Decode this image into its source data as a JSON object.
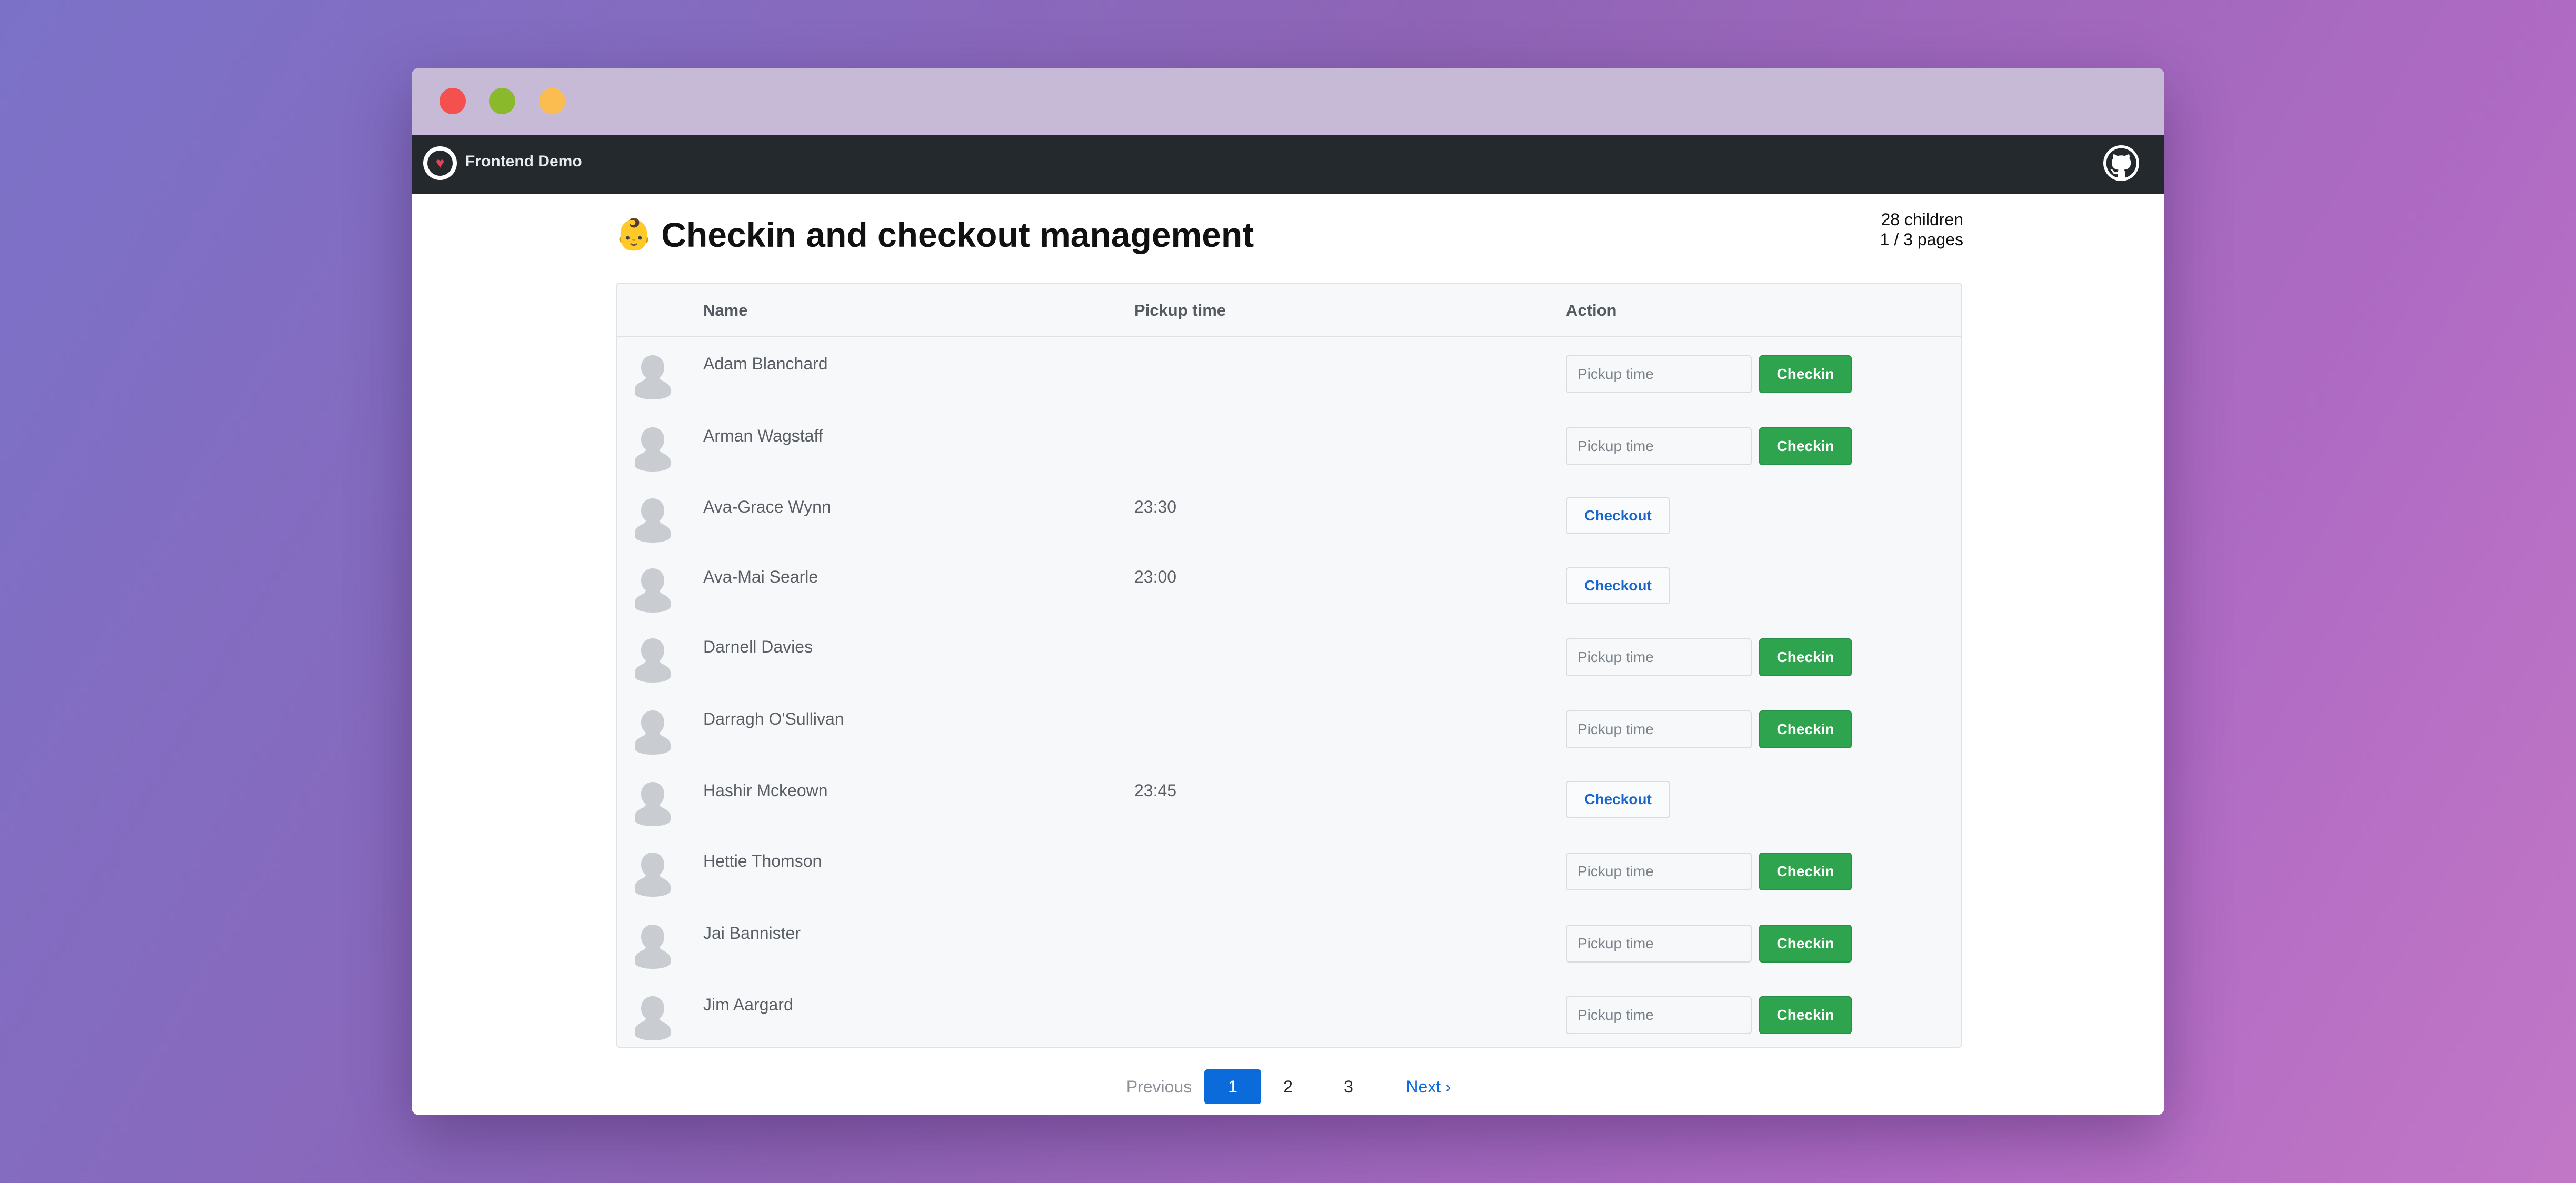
{
  "window": {
    "traffic_lights": {
      "close": "#f4504e",
      "minimize": "#8bb92c",
      "zoom": "#fbbd4f"
    }
  },
  "navbar": {
    "brand_name": "Frontend Demo",
    "brand_icon": "heart-logo-icon",
    "right_icon": "github-icon"
  },
  "header": {
    "emoji": "👶",
    "title": "Checkin and checkout management",
    "children_count": "28 children",
    "pages": "1 / 3 pages"
  },
  "table": {
    "columns": {
      "name": "Name",
      "pickup": "Pickup time",
      "action": "Action"
    },
    "input_placeholder": "Pickup time",
    "checkin_label": "Checkin",
    "checkout_label": "Checkout",
    "rows": [
      {
        "name": "Adam Blanchard",
        "pickup_time": "",
        "status": "checkin"
      },
      {
        "name": "Arman Wagstaff",
        "pickup_time": "",
        "status": "checkin"
      },
      {
        "name": "Ava-Grace Wynn",
        "pickup_time": "23:30",
        "status": "checkout"
      },
      {
        "name": "Ava-Mai Searle",
        "pickup_time": "23:00",
        "status": "checkout"
      },
      {
        "name": "Darnell Davies",
        "pickup_time": "",
        "status": "checkin"
      },
      {
        "name": "Darragh O'Sullivan",
        "pickup_time": "",
        "status": "checkin"
      },
      {
        "name": "Hashir Mckeown",
        "pickup_time": "23:45",
        "status": "checkout"
      },
      {
        "name": "Hettie Thomson",
        "pickup_time": "",
        "status": "checkin"
      },
      {
        "name": "Jai Bannister",
        "pickup_time": "",
        "status": "checkin"
      },
      {
        "name": "Jim Aargard",
        "pickup_time": "",
        "status": "checkin"
      }
    ]
  },
  "pagination": {
    "previous": "Previous",
    "pages": [
      "1",
      "2",
      "3"
    ],
    "current": "1",
    "next": "Next ›"
  },
  "colors": {
    "navbar": "#24292e",
    "checkin_button": "#2ea44f",
    "checkout_text": "#1a66cc",
    "active_page": "#0b6bdb"
  }
}
